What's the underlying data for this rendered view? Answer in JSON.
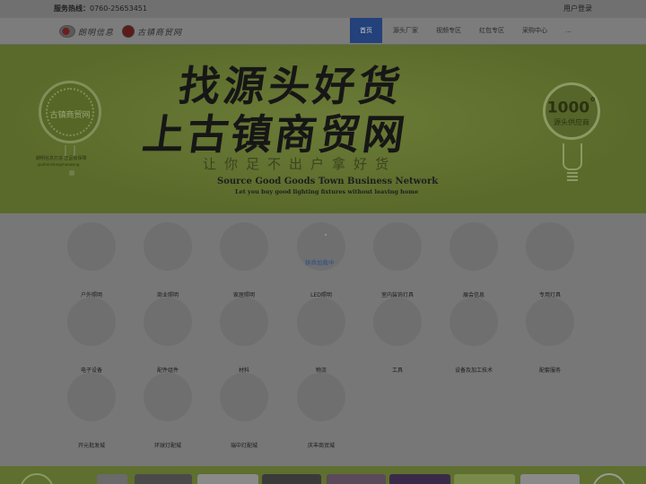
{
  "topbar": {
    "hotline_label": "服务热线：",
    "hotline_number": "0760-25653451",
    "login": "用户登录"
  },
  "header": {
    "logos": [
      {
        "icon": "brand-logo-icon",
        "text": "朗明信息"
      },
      {
        "icon": "guzhen-logo-icon",
        "text": "古镇商贸网"
      }
    ],
    "nav": [
      {
        "label": "首页",
        "active": true
      },
      {
        "label": "源头厂家"
      },
      {
        "label": "视频专区"
      },
      {
        "label": "红包专区"
      },
      {
        "label": "采购中心"
      },
      {
        "label": "..."
      }
    ]
  },
  "banner": {
    "headline_line1": "找源头好货",
    "headline_line2": "上古镇商贸网",
    "slogan": "让你足不出户拿好货",
    "english_title": "Source Good Goods Town Business Network",
    "english_subtitle": "Let you buy good lighting fixtures without leaving home",
    "left_badge": {
      "text": "古镇商贸网",
      "caption1": "朗明信息打造 正品有保障",
      "caption2": "guzhenshangmaowang"
    },
    "right_badge": {
      "number": "1000",
      "degree": "°",
      "text": "源头供应商"
    }
  },
  "loading_text": "拼命加载中",
  "categories": [
    {
      "label": "户外照明"
    },
    {
      "label": "商业照明"
    },
    {
      "label": "家居照明"
    },
    {
      "label": "LED照明"
    },
    {
      "label": "室内装饰灯具"
    },
    {
      "label": "展会信息"
    },
    {
      "label": "专用灯具"
    },
    {
      "label": "电子设备"
    },
    {
      "label": "配件组件"
    },
    {
      "label": "材料"
    },
    {
      "label": "物流"
    },
    {
      "label": "工具"
    },
    {
      "label": "设备及加工技术"
    },
    {
      "label": "配套服务"
    },
    {
      "label": "开元批发城"
    },
    {
      "label": "环球灯配城"
    },
    {
      "label": "瑞中灯配城"
    },
    {
      "label": "庆丰商贸城"
    }
  ],
  "colors": {
    "nav_active": "#23417a",
    "banner_green": "#5e6e2e",
    "loading_text": "#2a4f8a"
  }
}
